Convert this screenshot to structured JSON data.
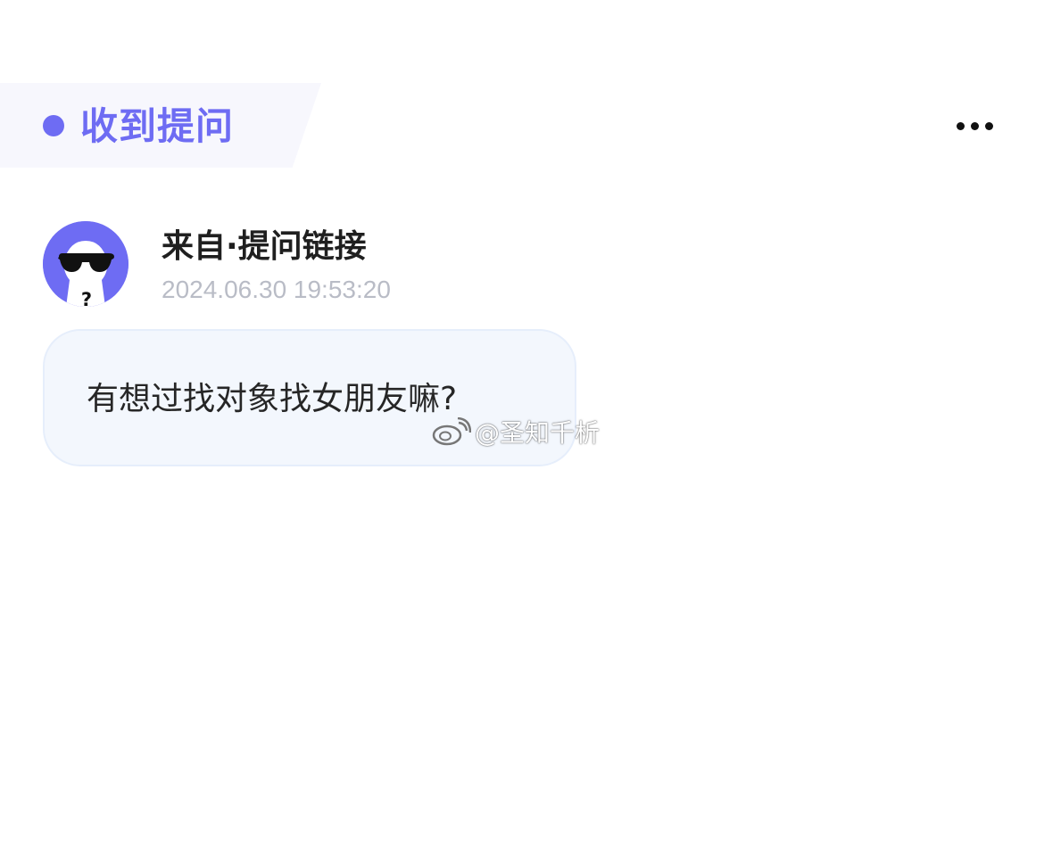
{
  "header": {
    "title": "收到提问",
    "dot_icon": "dot-icon",
    "more_icon": "more-horizontal-icon"
  },
  "message": {
    "sender": "来自·提问链接",
    "timestamp": "2024.06.30 19:53:20",
    "avatar_icon": "anonymous-sunglasses-avatar",
    "question": "有想过找对象找女朋友嘛?"
  },
  "watermark": {
    "icon": "weibo-logo-icon",
    "text": "@圣知千析"
  },
  "colors": {
    "accent": "#6e6cf3",
    "tab_background": "#f7f7fd",
    "bubble_background": "#f3f7fd",
    "timestamp": "#b9bcc6"
  }
}
